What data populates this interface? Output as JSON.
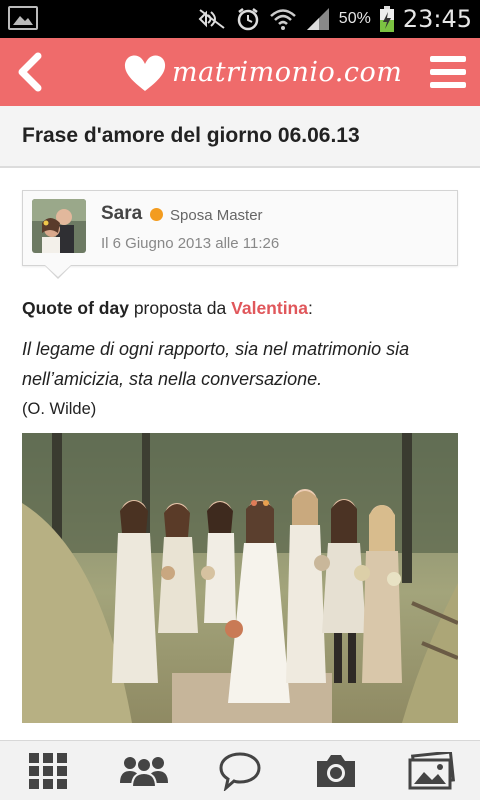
{
  "status_bar": {
    "battery_percent": "50%",
    "time": "23:45",
    "icons": [
      "image-notification-icon",
      "mute-icon",
      "alarm-icon",
      "wifi-icon",
      "signal-icon",
      "battery-charging-icon"
    ]
  },
  "app_bar": {
    "brand": "matrimonio.com",
    "color": "#ef6b6b",
    "icons": [
      "back-icon",
      "heart-logo-icon",
      "hamburger-menu-icon"
    ]
  },
  "page": {
    "title": "Frase d'amore del giorno 06.06.13"
  },
  "post": {
    "author_name": "Sara",
    "author_rank": "Sposa Master",
    "online_color": "#f39c1f",
    "date": "Il 6 Giugno 2013 alle 11:26",
    "quote_label": "Quote of day",
    "proposed_by": "proposta da",
    "proposer": "Valentina",
    "colon": ":",
    "quote_text": "Il legame di ogni rapporto, sia nel matrimonio sia nell’amicizia, sta nella conversazione.",
    "quote_source": "(O. Wilde)"
  },
  "bottom_nav": {
    "items": [
      "grid-menu-icon",
      "community-icon",
      "chat-bubble-icon",
      "camera-icon",
      "photo-gallery-icon"
    ]
  }
}
